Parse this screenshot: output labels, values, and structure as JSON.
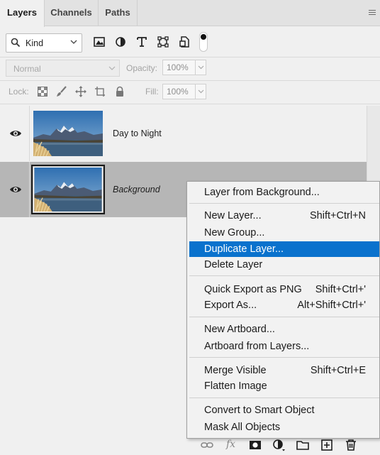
{
  "tabs": [
    {
      "label": "Layers",
      "active": true
    },
    {
      "label": "Channels",
      "active": false
    },
    {
      "label": "Paths",
      "active": false
    }
  ],
  "filter": {
    "kind_label": "Kind",
    "icons": [
      "image-filter-icon",
      "adjustment-filter-icon",
      "type-filter-icon",
      "shape-filter-icon",
      "smart-object-filter-icon",
      "filter-toggle-icon"
    ]
  },
  "blend": {
    "mode": "Normal",
    "opacity_label": "Opacity:",
    "opacity_value": "100%"
  },
  "lock": {
    "label": "Lock:",
    "fill_label": "Fill:",
    "fill_value": "100%"
  },
  "layers": [
    {
      "name": "Day to Night",
      "visible": true,
      "selected": false
    },
    {
      "name": "Background",
      "visible": true,
      "selected": true
    }
  ],
  "context_menu": {
    "highlight_color": "#0a72cd",
    "items": [
      {
        "label": "Layer from Background...",
        "shortcut": ""
      },
      {
        "label": "New Layer...",
        "shortcut": "Shift+Ctrl+N"
      },
      {
        "label": "New Group...",
        "shortcut": ""
      },
      {
        "label": "Duplicate Layer...",
        "shortcut": "",
        "highlighted": true
      },
      {
        "label": "Delete Layer",
        "shortcut": ""
      },
      {
        "label": "Quick Export as PNG",
        "shortcut": "Shift+Ctrl+'"
      },
      {
        "label": "Export As...",
        "shortcut": "Alt+Shift+Ctrl+'"
      },
      {
        "label": "New Artboard...",
        "shortcut": ""
      },
      {
        "label": "Artboard from Layers...",
        "shortcut": ""
      },
      {
        "label": "Merge Visible",
        "shortcut": "Shift+Ctrl+E"
      },
      {
        "label": "Flatten Image",
        "shortcut": ""
      },
      {
        "label": "Convert to Smart Object",
        "shortcut": ""
      },
      {
        "label": "Mask All Objects",
        "shortcut": ""
      }
    ]
  },
  "bottom_bar": {
    "fx_label": "fx",
    "icons": [
      "link-layers-icon",
      "fx-icon",
      "add-mask-icon",
      "adjustment-layer-icon",
      "new-group-icon",
      "new-layer-icon",
      "trash-icon"
    ]
  }
}
